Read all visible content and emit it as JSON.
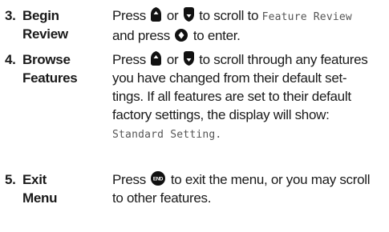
{
  "steps": [
    {
      "number": "3.",
      "title_line1": "Begin",
      "title_line2": "Review",
      "body": {
        "t1": "Press",
        "t2": "or",
        "t3": "to scroll to",
        "lcd1": "Feature Review",
        "t4": "and press",
        "t5": "to enter."
      },
      "icons": [
        "scroll-up-key-icon",
        "scroll-down-key-icon",
        "select-key-icon"
      ]
    },
    {
      "number": "4.",
      "title_line1": "Browse",
      "title_line2": "Features",
      "body": {
        "t1": "Press",
        "t2": "or",
        "t3": "to scroll through any features",
        "line2": "you have changed from their default set-",
        "line3": "tings. If all features are set to their default",
        "line4": "factory settings, the display will show:",
        "lcd1": "Standard Setting."
      },
      "icons": [
        "scroll-up-key-icon",
        "scroll-down-key-icon"
      ]
    },
    {
      "number": "5.",
      "title_line1": "Exit",
      "title_line2": "Menu",
      "body": {
        "t1": "Press",
        "t2": "to exit the menu, or you may scroll",
        "line2": "to other features.",
        "end_key_label": "END"
      },
      "icons": [
        "end-key-icon"
      ]
    }
  ]
}
